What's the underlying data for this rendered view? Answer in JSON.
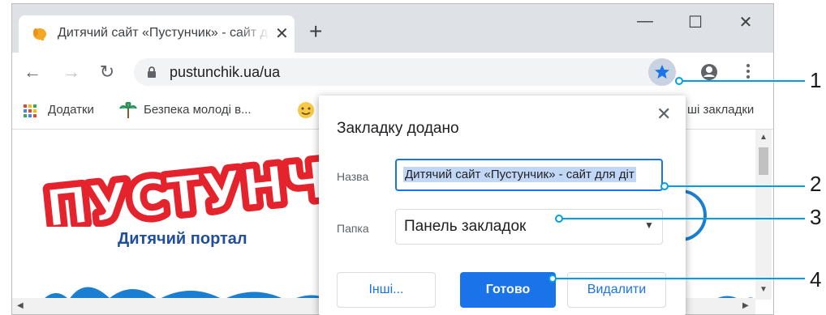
{
  "tab": {
    "title": "Дитячий сайт «Пустунчик» - сайт для дітей",
    "favicon": "elephant-icon"
  },
  "window_controls": {
    "minimize": "—",
    "maximize": "☐",
    "close": "✕"
  },
  "tab_close": "✕",
  "new_tab": "+",
  "toolbar": {
    "back": "←",
    "forward": "→",
    "reload": "↻",
    "url": "pustunchik.ua/ua"
  },
  "bookmarks_bar": {
    "items": [
      {
        "label": "Додатки",
        "icon": "apps-grid-icon"
      },
      {
        "label": "Безпека молоді в...",
        "icon": "palm-tree-icon"
      }
    ],
    "other": "ші закладки"
  },
  "page": {
    "logo_text": "ПУСТУНЧИ",
    "subtitle": "Дитячий портал"
  },
  "dialog": {
    "title": "Закладку додано",
    "close": "✕",
    "name_label": "Назва",
    "name_value": "Дитячий сайт «Пустунчик» - сайт для діт",
    "folder_label": "Папка",
    "folder_value": "Панель закладок",
    "btn_other": "Інші...",
    "btn_done": "Готово",
    "btn_remove": "Видалити"
  },
  "callouts": [
    "1",
    "2",
    "3",
    "4"
  ],
  "colors": {
    "accent": "#1a73e8",
    "callout": "#009fe3",
    "logo_red": "#e5232c",
    "logo_blue": "#1f4e9c"
  }
}
